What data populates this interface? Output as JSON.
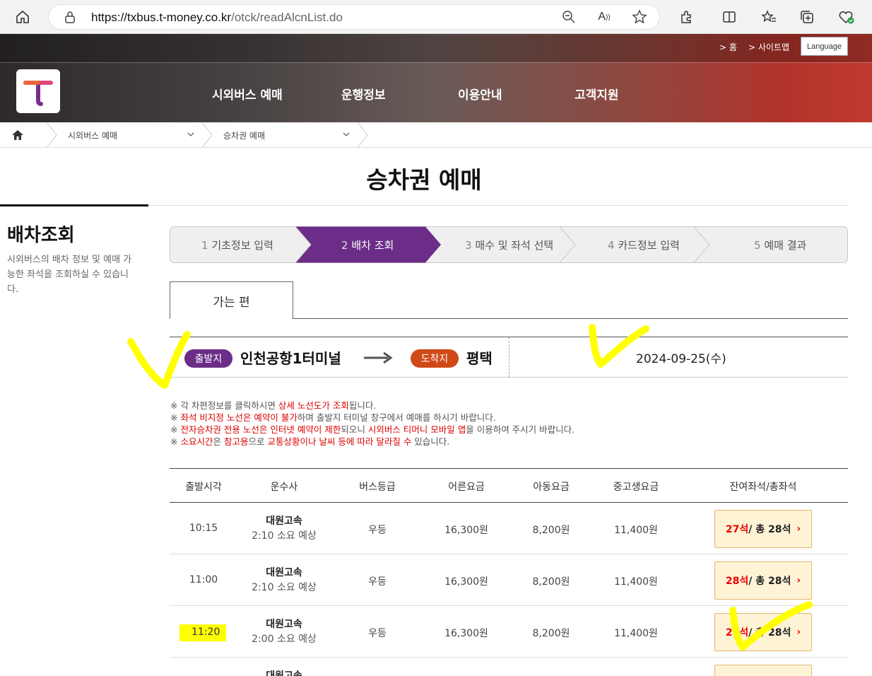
{
  "browser": {
    "url_host": "https://txbus.t-money.co.kr",
    "url_path": "/otck/readAlcnList.do"
  },
  "header": {
    "util_home": "> 홈",
    "util_sitemap": "> 사이트맵",
    "language": "Language",
    "nav": [
      "시외버스 예매",
      "운행정보",
      "이용안내",
      "고객지원"
    ]
  },
  "breadcrumb": {
    "level1": "시외버스 예매",
    "level2": "승차권 예매"
  },
  "page_title": "승차권 예매",
  "side": {
    "title": "배차조회",
    "desc": "시외버스의 배차 정보 및 예매 가능한 좌석을 조회하실 수 있습니다."
  },
  "steps": [
    {
      "num": "1",
      "label": "기초정보 입력"
    },
    {
      "num": "2",
      "label": "배차 조회"
    },
    {
      "num": "3",
      "label": "매수 및 좌석 선택"
    },
    {
      "num": "4",
      "label": "카드정보 입력"
    },
    {
      "num": "5",
      "label": "예매 결과"
    }
  ],
  "tab": "가는 편",
  "route": {
    "dep_badge": "출발지",
    "dep_name": "인천공항1터미널",
    "arr_badge": "도착지",
    "arr_name": "평택",
    "date": "2024-09-25(수)"
  },
  "notes": {
    "n1a": "※ 각 차편정보를 클릭하시면 ",
    "n1b": "상세 노선도가 조회",
    "n1c": "됩니다.",
    "n2a": "※ ",
    "n2b": "좌석 비지정 노선은 예약이 불가",
    "n2c": "하며 출발지 터미널 창구에서 예매를 하시기 바랍니다.",
    "n3a": "※ ",
    "n3b": "전자승차권 전용 노선은 인터넷 예약이 제한",
    "n3c": "되오니 ",
    "n3d": "시외버스 티머니 모바일 앱",
    "n3e": "을 이용하여 주시기 바랍니다.",
    "n4a": "※ ",
    "n4b": "소요시간",
    "n4c": "은 ",
    "n4d": "참고용",
    "n4e": "으로 ",
    "n4f": "교통상황이나 날씨 등에 따라 달라질 수",
    "n4g": " 있습니다."
  },
  "table": {
    "headers": [
      "출발시각",
      "운수사",
      "버스등급",
      "어른요금",
      "아동요금",
      "중고생요금",
      "잔여좌석/총좌석"
    ],
    "rows": [
      {
        "time": "10:15",
        "company": "대원고속",
        "duration": "2:10 소요 예상",
        "grade": "우등",
        "adult": "16,300원",
        "child": "8,200원",
        "teen": "11,400원",
        "remain": "27석",
        "total": " / 총 28석"
      },
      {
        "time": "11:00",
        "company": "대원고속",
        "duration": "2:10 소요 예상",
        "grade": "우등",
        "adult": "16,300원",
        "child": "8,200원",
        "teen": "11,400원",
        "remain": "28석",
        "total": " / 총 28석"
      },
      {
        "time": "11:20",
        "company": "대원고속",
        "duration": "2:00 소요 예상",
        "grade": "우등",
        "adult": "16,300원",
        "child": "8,200원",
        "teen": "11,400원",
        "remain": "27석",
        "total": " / 총 28석"
      },
      {
        "company": "대원고속"
      }
    ]
  },
  "colors": {
    "active_step": "#6b2d87",
    "dep_badge": "#6b2d87",
    "arr_badge": "#cf4a16",
    "seat_highlight": "#e00000",
    "annotation": "#ffff00"
  }
}
